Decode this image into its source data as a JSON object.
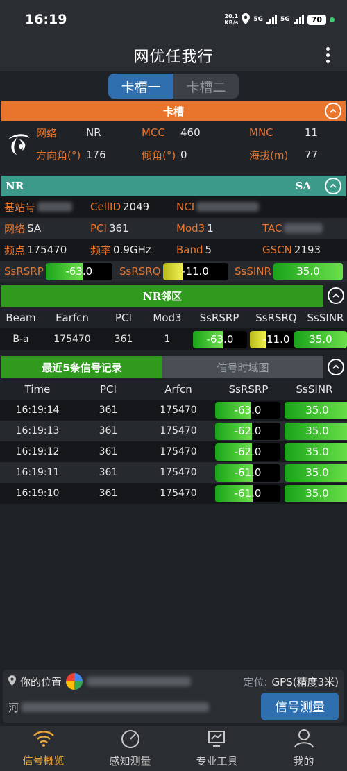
{
  "status": {
    "time": "16:19",
    "speed": "20.1",
    "speed_unit": "KB/s",
    "net1": "5G",
    "net2": "5G",
    "battery": "70"
  },
  "app": {
    "title": "网优任我行"
  },
  "sim_tabs": [
    "卡槽一",
    "卡槽二"
  ],
  "card": {
    "header": "卡槽",
    "labels": {
      "network": "网络",
      "mcc": "MCC",
      "mnc": "MNC",
      "azimuth": "方向角(°)",
      "tilt": "倾角(°)",
      "altitude": "海拔(m)"
    },
    "values": {
      "network": "NR",
      "mcc": "460",
      "mnc": "11",
      "azimuth": "176",
      "tilt": "0",
      "altitude": "77"
    }
  },
  "nr": {
    "header_left": "NR",
    "header_center": "SA",
    "labels": {
      "station": "基站号",
      "cellid": "CellID",
      "nci": "NCI",
      "network": "网络",
      "pci": "PCI",
      "mod3": "Mod3",
      "tac": "TAC",
      "earfcn": "频点",
      "freq": "频率",
      "band": "Band",
      "gscn": "GSCN",
      "rsrp": "SsRSRP",
      "rsrq": "SsRSRQ",
      "sinr": "SsSINR"
    },
    "values": {
      "cellid": "2049",
      "network": "SA",
      "pci": "361",
      "mod3": "1",
      "earfcn": "175470",
      "freq": "0.9GHz",
      "band": "5",
      "gscn": "2193",
      "rsrp": "-63.0",
      "rsrq": "-11.0",
      "sinr": "35.0"
    },
    "levels": {
      "rsrp": 0.55,
      "rsrq": 0.3,
      "sinr": 1.0
    }
  },
  "neighbors": {
    "header": "NR邻区",
    "columns": [
      "Beam",
      "Earfcn",
      "PCI",
      "Mod3",
      "SsRSRP",
      "SsRSRQ",
      "SsSINR"
    ],
    "row": {
      "beam": "B-a",
      "earfcn": "175470",
      "pci": "361",
      "mod3": "1",
      "rsrp": "-63.0",
      "rsrq": "-11.0",
      "sinr": "35.0"
    },
    "levels": {
      "rsrp": 0.55,
      "rsrq": 0.3,
      "sinr": 1.0
    }
  },
  "records": {
    "tab_active": "最近5条信号记录",
    "tab_inactive": "信号时域图",
    "columns": [
      "Time",
      "PCI",
      "Arfcn",
      "SsRSRP",
      "SsSINR"
    ],
    "rows": [
      {
        "time": "16:19:14",
        "pci": "361",
        "arfcn": "175470",
        "rsrp": "-63.0",
        "sinr": "35.0",
        "rsrp_level": 0.55
      },
      {
        "time": "16:19:13",
        "pci": "361",
        "arfcn": "175470",
        "rsrp": "-62.0",
        "sinr": "35.0",
        "rsrp_level": 0.56
      },
      {
        "time": "16:19:12",
        "pci": "361",
        "arfcn": "175470",
        "rsrp": "-62.0",
        "sinr": "35.0",
        "rsrp_level": 0.56
      },
      {
        "time": "16:19:11",
        "pci": "361",
        "arfcn": "175470",
        "rsrp": "-61.0",
        "sinr": "35.0",
        "rsrp_level": 0.57
      },
      {
        "time": "16:19:10",
        "pci": "361",
        "arfcn": "175470",
        "rsrp": "-61.0",
        "sinr": "35.0",
        "rsrp_level": 0.57
      }
    ]
  },
  "location": {
    "label": "你的位置",
    "position_label": "定位:",
    "position_value": "GPS(精度3米)",
    "address_prefix": "河",
    "measure_button": "信号测量"
  },
  "nav": [
    "信号概览",
    "感知测量",
    "专业工具",
    "我的"
  ],
  "colors": {
    "accent_orange": "#e9752d",
    "teal": "#3b9a8a",
    "green": "#2f9a1e",
    "blue": "#2f6fb0"
  }
}
